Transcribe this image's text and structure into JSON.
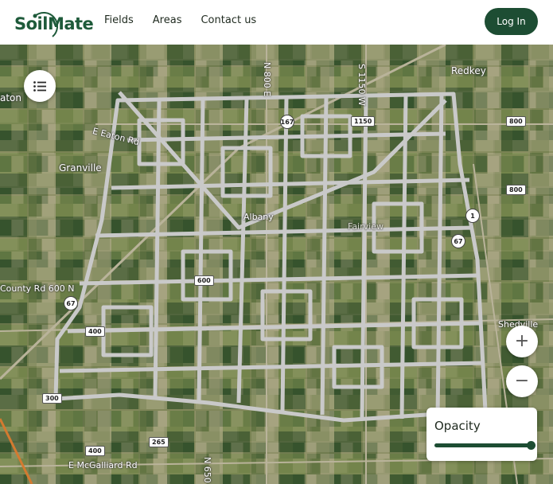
{
  "brand": {
    "name": "SoilMate",
    "color": "#1e5a3a"
  },
  "nav": {
    "items": [
      "Fields",
      "Areas",
      "Contact us"
    ]
  },
  "header": {
    "login_label": "Log In"
  },
  "map": {
    "places": [
      "Redkey",
      "Granville",
      "Albany",
      "Fairview",
      "Shedville",
      "aton"
    ],
    "roads": [
      "E Eaton Rd",
      "County Rd 600 N",
      "E McGalliard Rd",
      "N 800 E",
      "S 1150 W",
      "N 650"
    ],
    "route_shields": [
      "800",
      "800",
      "1150",
      "400",
      "300",
      "265",
      "400",
      "600",
      "67",
      "1",
      "167",
      "67"
    ],
    "overlay_color": "#c9c9c9"
  },
  "controls": {
    "list_icon": "list-icon",
    "zoom_in_symbol": "+",
    "zoom_out_symbol": "−",
    "opacity_label": "Opacity",
    "opacity_value": 1.0
  }
}
